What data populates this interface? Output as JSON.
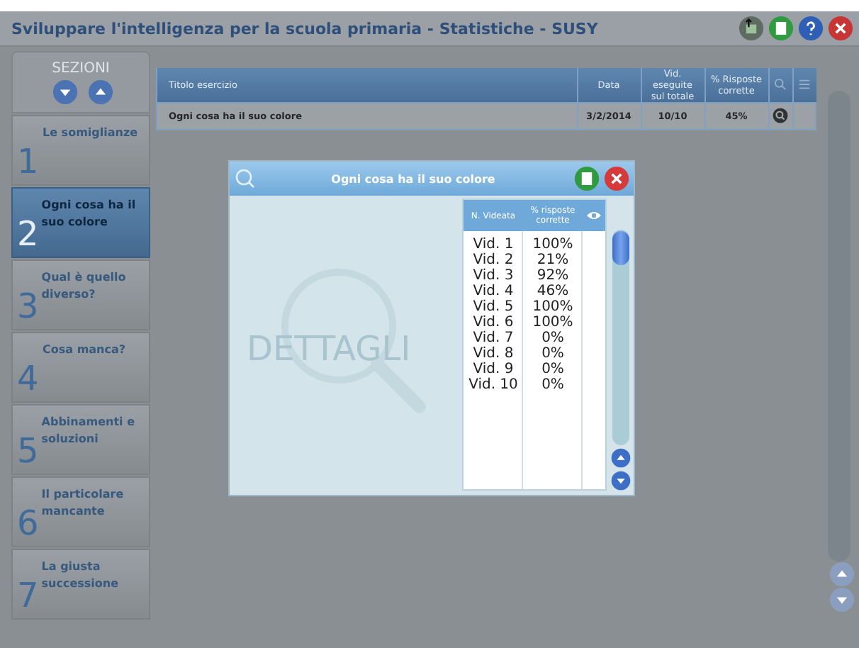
{
  "window": {
    "title": "Sviluppare l'intelligenza per la scuola primaria - Statistiche - SUSY"
  },
  "sidebar": {
    "header": "SEZIONI",
    "sections": [
      {
        "number": "1",
        "label": "Le somiglianze",
        "selected": false
      },
      {
        "number": "2",
        "label": "Ogni cosa ha il suo colore",
        "selected": true
      },
      {
        "number": "3",
        "label": "Qual è quello diverso?",
        "selected": false
      },
      {
        "number": "4",
        "label": "Cosa manca?",
        "selected": false
      },
      {
        "number": "5",
        "label": "Abbinamenti e soluzioni",
        "selected": false
      },
      {
        "number": "6",
        "label": "Il particolare mancante",
        "selected": false
      },
      {
        "number": "7",
        "label": "La giusta successione",
        "selected": false
      }
    ]
  },
  "table": {
    "columns": [
      "Titolo esercizio",
      "Data",
      "Vid. eseguite sul totale",
      "% Risposte corrette"
    ],
    "rows": [
      {
        "cells": [
          "Ogni cosa ha il suo colore",
          "3/2/2014",
          "10/10",
          "45%"
        ]
      }
    ]
  },
  "dialog": {
    "title": "Ogni cosa ha il suo colore",
    "background_text": "DETTAGLI",
    "columns": [
      "N. Videata",
      "% risposte corrette"
    ],
    "rows": [
      {
        "video": "Vid. 1",
        "percent": "100%"
      },
      {
        "video": "Vid. 2",
        "percent": "21%"
      },
      {
        "video": "Vid. 3",
        "percent": "92%"
      },
      {
        "video": "Vid. 4",
        "percent": "46%"
      },
      {
        "video": "Vid. 5",
        "percent": "100%"
      },
      {
        "video": "Vid. 6",
        "percent": "100%"
      },
      {
        "video": "Vid. 7",
        "percent": "0%"
      },
      {
        "video": "Vid. 8",
        "percent": "0%"
      },
      {
        "video": "Vid. 9",
        "percent": "0%"
      },
      {
        "video": "Vid. 10",
        "percent": "0%"
      }
    ]
  }
}
